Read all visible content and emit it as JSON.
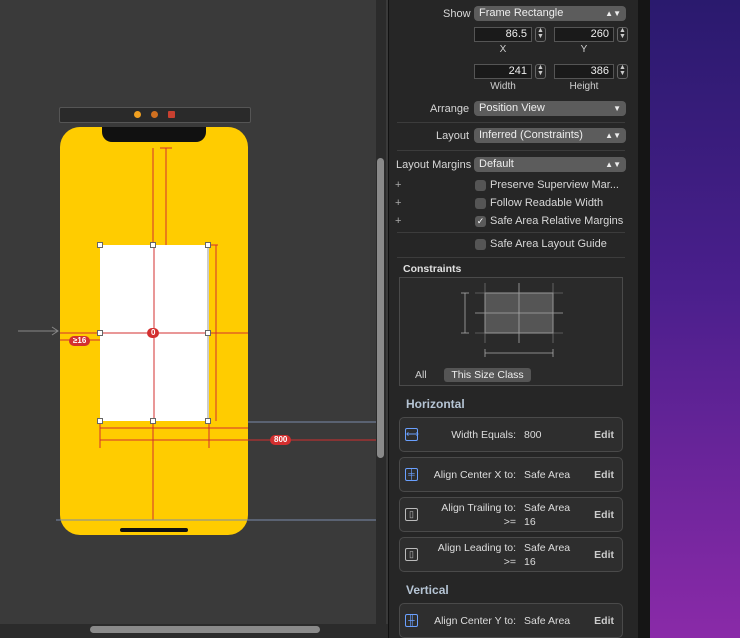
{
  "canvas": {
    "badge_center": "0",
    "badge_leading": "≥16",
    "badge_width": "800"
  },
  "inspector": {
    "show_label": "Show",
    "show_value": "Frame Rectangle",
    "x_value": "86.5",
    "x_label": "X",
    "y_value": "260",
    "y_label": "Y",
    "width_value": "241",
    "width_label": "Width",
    "height_value": "386",
    "height_label": "Height",
    "arrange_label": "Arrange",
    "arrange_value": "Position View",
    "layout_label": "Layout",
    "layout_value": "Inferred (Constraints)",
    "margins_label": "Layout Margins",
    "margins_value": "Default",
    "checkboxes": [
      {
        "label": "Preserve Superview Mar...",
        "checked": false
      },
      {
        "label": "Follow Readable Width",
        "checked": false
      },
      {
        "label": "Safe Area Relative Margins",
        "checked": true
      },
      {
        "label": "Safe Area Layout Guide",
        "checked": false
      }
    ],
    "constraints_title": "Constraints",
    "tab_all": "All",
    "tab_size_class": "This Size Class",
    "horizontal_title": "Horizontal",
    "vertical_title": "Vertical",
    "edit_label": "Edit",
    "constraints": [
      {
        "line1_label": "Width Equals:",
        "line1_value": "800",
        "line2_label": "",
        "line2_value": ""
      },
      {
        "line1_label": "Align Center X to:",
        "line1_value": "Safe Area",
        "line2_label": "",
        "line2_value": ""
      },
      {
        "line1_label": "Align Trailing to:",
        "line1_value": "Safe Area",
        "line2_label": ">=",
        "line2_value": "16"
      },
      {
        "line1_label": "Align Leading to:",
        "line1_value": "Safe Area",
        "line2_label": ">=",
        "line2_value": "16"
      },
      {
        "line1_label": "Align Center Y to:",
        "line1_value": "Safe Area",
        "line2_label": "",
        "line2_value": ""
      }
    ]
  }
}
